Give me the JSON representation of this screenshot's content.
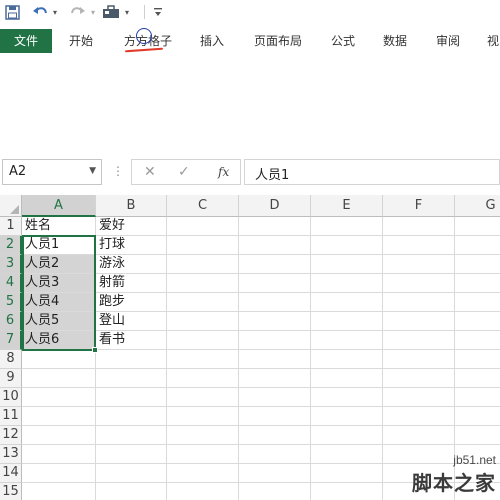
{
  "ribbon": {
    "tabs": [
      {
        "label": "文件"
      },
      {
        "label": "开始"
      },
      {
        "label": "方方格子"
      },
      {
        "label": "插入"
      },
      {
        "label": "页面布局"
      },
      {
        "label": "公式"
      },
      {
        "label": "数据"
      },
      {
        "label": "审阅"
      },
      {
        "label": "视"
      }
    ],
    "active_tab_color": "#217346"
  },
  "formula_bar": {
    "name_box": "A2",
    "function_label": "fx",
    "cancel_symbol": "✕",
    "enter_symbol": "✓",
    "content": "人员1"
  },
  "sheet": {
    "columns": [
      "A",
      "B",
      "C",
      "D",
      "E",
      "F",
      "G"
    ],
    "rows": [
      "1",
      "2",
      "3",
      "4",
      "5",
      "6",
      "7",
      "8",
      "9",
      "10",
      "11",
      "12",
      "13",
      "14",
      "15"
    ],
    "cells": {
      "A1": "姓名",
      "B1": "爱好",
      "A2": "人员1",
      "B2": "打球",
      "A3": "人员2",
      "B3": "游泳",
      "A4": "人员3",
      "B4": "射箭",
      "A5": "人员4",
      "B5": "跑步",
      "A6": "人员5",
      "B6": "登山",
      "A7": "人员6",
      "B7": "看书"
    },
    "selection": "A2:A7",
    "selection_color": "#217346"
  },
  "watermark": {
    "site": "jb51.net",
    "name": "脚本之家"
  }
}
